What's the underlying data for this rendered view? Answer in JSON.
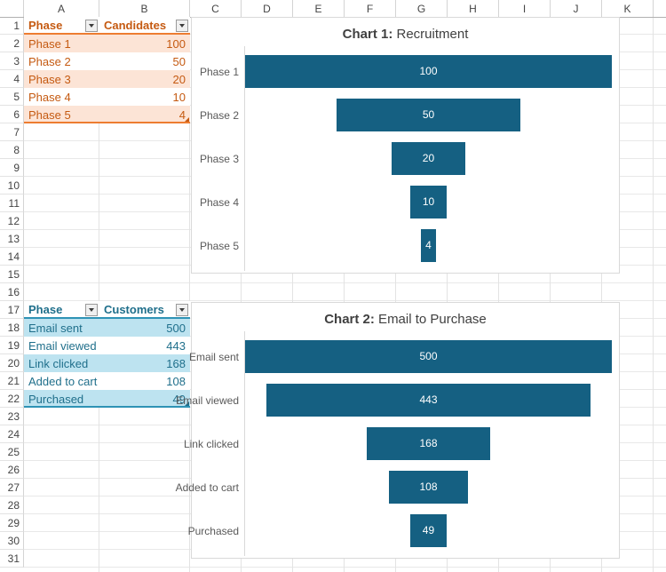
{
  "spreadsheet": {
    "columns": [
      "A",
      "B",
      "C",
      "D",
      "E",
      "F",
      "G",
      "H",
      "I",
      "J",
      "K"
    ],
    "rows": [
      "1",
      "2",
      "3",
      "4",
      "5",
      "6",
      "7",
      "8",
      "9",
      "10",
      "11",
      "12",
      "13",
      "14",
      "15",
      "16",
      "17",
      "18",
      "19",
      "20",
      "21",
      "22",
      "23",
      "24",
      "25",
      "26",
      "27",
      "28",
      "29",
      "30",
      "31"
    ],
    "filter_icon": "filter-dropdown-icon"
  },
  "table_recruitment": {
    "header": [
      "Phase",
      "Candidates"
    ],
    "rows": [
      {
        "phase": "Phase 1",
        "value": "100"
      },
      {
        "phase": "Phase 2",
        "value": "50"
      },
      {
        "phase": "Phase 3",
        "value": "20"
      },
      {
        "phase": "Phase 4",
        "value": "10"
      },
      {
        "phase": "Phase 5",
        "value": "4"
      }
    ],
    "accent": "#ED7D31",
    "text_color": "#C55A11",
    "band_color": "#FCE4D6"
  },
  "table_email": {
    "header": [
      "Phase",
      "Customers"
    ],
    "rows": [
      {
        "phase": "Email sent",
        "value": "500"
      },
      {
        "phase": "Email viewed",
        "value": "443"
      },
      {
        "phase": "Link clicked",
        "value": "168"
      },
      {
        "phase": "Added to cart",
        "value": "108"
      },
      {
        "phase": "Purchased",
        "value": "49"
      }
    ],
    "accent": "#2E93B5",
    "text_color": "#1F6F8B",
    "band_color": "#BDE3F0"
  },
  "chart_data": [
    {
      "type": "bar",
      "chart_label": "Chart 1:",
      "title_rest": " Recruitment",
      "title": "Chart 1: Recruitment",
      "categories": [
        "Phase 1",
        "Phase 2",
        "Phase 3",
        "Phase 4",
        "Phase 5"
      ],
      "values": [
        100,
        50,
        20,
        10,
        4
      ],
      "series": [
        {
          "name": "Candidates",
          "values": [
            100,
            50,
            20,
            10,
            4
          ]
        }
      ],
      "xlabel": "",
      "ylabel": "",
      "xlim": [
        0,
        100
      ],
      "grid": false,
      "legend": "none",
      "bar_color": "#156082",
      "data_labels": [
        "100",
        "50",
        "20",
        "10",
        "4"
      ],
      "funnel_centered": true
    },
    {
      "type": "bar",
      "chart_label": "Chart 2:",
      "title_rest": " Email to Purchase",
      "title": "Chart 2: Email to Purchase",
      "categories": [
        "Email sent",
        "Email viewed",
        "Link clicked",
        "Added to cart",
        "Purchased"
      ],
      "values": [
        500,
        443,
        168,
        108,
        49
      ],
      "series": [
        {
          "name": "Customers",
          "values": [
            500,
            443,
            168,
            108,
            49
          ]
        }
      ],
      "xlabel": "",
      "ylabel": "",
      "xlim": [
        0,
        500
      ],
      "grid": false,
      "legend": "none",
      "bar_color": "#156082",
      "data_labels": [
        "500",
        "443",
        "168",
        "108",
        "49"
      ],
      "funnel_centered": true
    }
  ]
}
